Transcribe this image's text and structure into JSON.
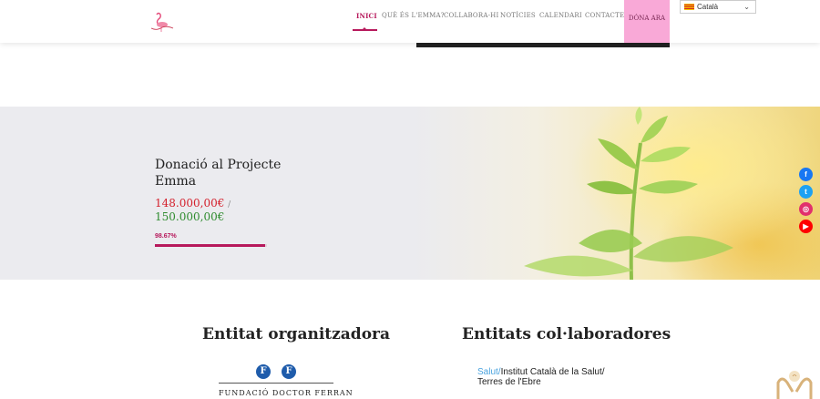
{
  "header": {
    "logo_icon": "flamingo-logo-icon",
    "nav": [
      {
        "label": "INICI",
        "active": true
      },
      {
        "label": "QUÈ ÉS L'EMMA?",
        "active": false
      },
      {
        "label": "COLLABORA-HI",
        "active": false
      },
      {
        "label": "NOTÍCIES",
        "active": false
      },
      {
        "label": "CALENDARI",
        "active": false
      },
      {
        "label": "CONTACTE",
        "active": false
      }
    ],
    "donate_label": "DÓNA ARA",
    "language": {
      "selected": "Català",
      "flag_icon": "catalan-flag-icon"
    }
  },
  "donation": {
    "title": "Donació al Projecte Emma",
    "raised": "148.000,00€",
    "separator": "/",
    "goal": "150.000,00€",
    "percent_label": "98.67%",
    "progress": 0.9867
  },
  "social": [
    {
      "name": "facebook",
      "glyph": "f",
      "color": "#1877f2"
    },
    {
      "name": "twitter",
      "glyph": "t",
      "color": "#1da1f2"
    },
    {
      "name": "instagram",
      "glyph": "◎",
      "color": "#e1306c"
    },
    {
      "name": "youtube",
      "glyph": "▶",
      "color": "#ff0000"
    }
  ],
  "entities": {
    "organizer_heading": "Entitat organitzadora",
    "collaborators_heading": "Entitats col·laboradores",
    "organizer_logo_text": "FUNDACIÓ DOCTOR FERRAN",
    "organizer_logo_letter": "F",
    "collab_logo": {
      "salut": "Salut/",
      "line1": "Institut Català de la Salut/",
      "line2": "Terres de l'Ebre"
    }
  },
  "colors": {
    "accent": "#b7195c",
    "donate_bg": "#f9a9d7",
    "raised": "#d4202c",
    "goal": "#2e8b2e"
  }
}
